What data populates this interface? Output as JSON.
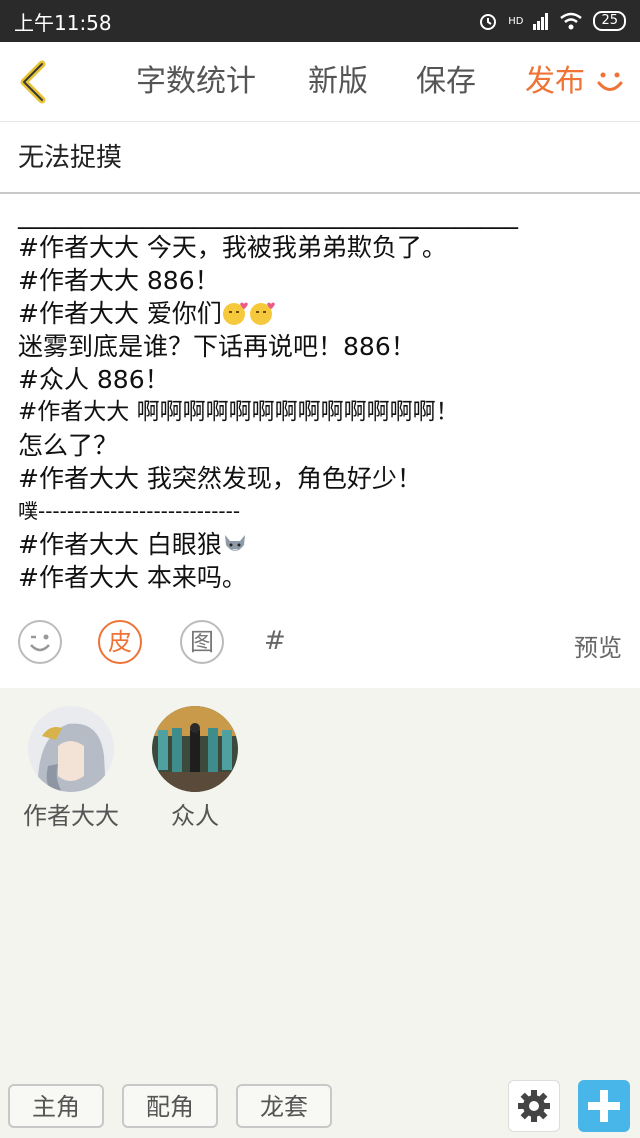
{
  "status": {
    "time": "上午11:58",
    "network": "HD",
    "battery": "25"
  },
  "toolbar": {
    "word_count": "字数统计",
    "new_version": "新版",
    "save": "保存",
    "publish": "发布",
    "smile_icon": "smile-icon"
  },
  "editor": {
    "title": "无法捉摸",
    "lines": [
      "________________________________________",
      "#作者大大 今天，我被我弟弟欺负了。",
      "#作者大大 886！",
      "#作者大大 爱你们",
      "迷雾到底是谁？下话再说吧！886！",
      "#众人 886！",
      "#作者大大 啊啊啊啊啊啊啊啊啊啊啊啊啊！",
      "怎么了？",
      "#作者大大 我突然发现，角色好少！",
      "噗----------------------------",
      "#作者大大 白眼狼",
      "#作者大大 本来吗。"
    ]
  },
  "actions": {
    "skin": "皮",
    "image": "图",
    "hash": "#",
    "preview": "预览"
  },
  "characters": [
    {
      "name": "作者大大"
    },
    {
      "name": "众人"
    }
  ],
  "role_tabs": {
    "main": "主角",
    "supporting": "配角",
    "extra": "龙套"
  },
  "colors": {
    "accent": "#ef7336",
    "plus_button": "#49b6ea",
    "panel_bg": "#f3f4ee",
    "back_arrow": "#e6c234"
  }
}
